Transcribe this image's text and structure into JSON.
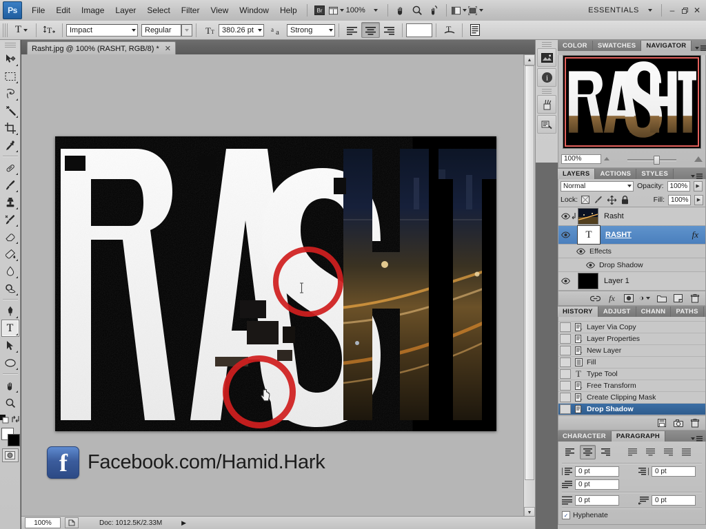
{
  "app": {
    "name": "Ps",
    "workspace": "ESSENTIALS"
  },
  "menubar": {
    "items": [
      "File",
      "Edit",
      "Image",
      "Layer",
      "Select",
      "Filter",
      "View",
      "Window",
      "Help"
    ],
    "bridge_icon": "bridge-icon",
    "arrange_icon": "arrange-documents-icon",
    "zoom_level": "100%",
    "hand_icon": "hand-tool-icon",
    "zoom_icon": "zoom-tool-icon",
    "rotate_icon": "rotate-view-tool-icon",
    "screen_mode_icon": "screen-mode-icon",
    "extras_icon": "view-extras-icon",
    "minimize": "–",
    "restore": "❐",
    "close": "✕"
  },
  "options_bar": {
    "tool_icon_label": "T",
    "orientation_label": "toggle-text-orientation",
    "font_family": "Impact",
    "font_style": "Regular",
    "font_size": "380.26 pt",
    "anti_alias": "Strong",
    "align_left": "align-text-left",
    "align_center": "align-text-center",
    "align_right": "align-text-right",
    "color_swatch": "#ffffff",
    "warp_label": "create-warped-text",
    "panel_toggle_label": "toggle-character-paragraph-panels"
  },
  "toolbar": {
    "tools": [
      {
        "name": "move-tool",
        "glyph": "✥",
        "active": false
      },
      {
        "name": "rectangular-marquee-tool",
        "glyph": "⬚",
        "active": false
      },
      {
        "name": "lasso-tool",
        "glyph": "❀",
        "active": false
      },
      {
        "name": "magic-wand-tool",
        "glyph": "✳",
        "active": false
      },
      {
        "name": "crop-tool",
        "glyph": "⌗",
        "active": false
      },
      {
        "name": "eyedropper-tool",
        "glyph": "✐",
        "active": false
      },
      {
        "name": "healing-brush-tool",
        "glyph": "⊘",
        "active": false
      },
      {
        "name": "brush-tool",
        "glyph": "✎",
        "active": false
      },
      {
        "name": "clone-stamp-tool",
        "glyph": "✑",
        "active": false
      },
      {
        "name": "history-brush-tool",
        "glyph": "✒",
        "active": false
      },
      {
        "name": "eraser-tool",
        "glyph": "▱",
        "active": false
      },
      {
        "name": "gradient-tool",
        "glyph": "◧",
        "active": false
      },
      {
        "name": "blur-tool",
        "glyph": "●",
        "active": false
      },
      {
        "name": "dodge-tool",
        "glyph": "◖",
        "active": false
      },
      {
        "name": "pen-tool",
        "glyph": "✒",
        "active": false
      },
      {
        "name": "horizontal-type-tool",
        "glyph": "T",
        "active": true
      },
      {
        "name": "path-selection-tool",
        "glyph": "➤",
        "active": false
      },
      {
        "name": "ellipse-shape-tool",
        "glyph": "⬭",
        "active": false
      },
      {
        "name": "hand-tool",
        "glyph": "✋",
        "active": false
      },
      {
        "name": "zoom-tool",
        "glyph": "⚲",
        "active": false
      }
    ],
    "foreground_color": "#ffffff",
    "background_color": "#000000",
    "swap_colors_icon": "swap-colors-icon",
    "quick_mask_icon": "quick-mask-mode-icon"
  },
  "document": {
    "tab_title": "Rasht.jpg @ 100% (RASHT, RGB/8) *",
    "close_glyph": "✕",
    "artwork_text": "RASHT",
    "footer_text": "Facebook.com/Hamid.Hark",
    "footer_icon": "facebook-icon",
    "facebook_glyph": "f",
    "annotation_1": "red-circle-annotation",
    "annotation_2": "red-circle-annotation",
    "cursor_text": "text-cursor-icon",
    "cursor_hand": "hand-pointer-icon"
  },
  "status_bar": {
    "zoom": "100%",
    "doc_info": "Doc: 1012.5K/2.33M",
    "arrow_glyph": "▶"
  },
  "icon_rail": {
    "buttons": [
      {
        "name": "mini-bridge-icon",
        "glyph": "⛰"
      },
      {
        "name": "info-icon",
        "glyph": "i"
      },
      {
        "name": "tool-presets-icon",
        "glyph": "⚒"
      },
      {
        "name": "brush-presets-icon",
        "glyph": "☷"
      }
    ]
  },
  "navigator_panel": {
    "tabs": [
      {
        "label": "COLOR",
        "selected": false
      },
      {
        "label": "SWATCHES",
        "selected": false
      },
      {
        "label": "NAVIGATOR",
        "selected": true
      }
    ],
    "thumbnail_text": "RASHT",
    "zoom_value": "100%",
    "zoom_out_icon": "zoom-out-icon",
    "zoom_in_icon": "zoom-in-icon",
    "menu_icon": "panel-menu-icon"
  },
  "layers_panel": {
    "tabs": [
      {
        "label": "LAYERS",
        "selected": true
      },
      {
        "label": "ACTIONS",
        "selected": false
      },
      {
        "label": "STYLES",
        "selected": false
      }
    ],
    "blend_mode": "Normal",
    "opacity_label": "Opacity:",
    "opacity_value": "100%",
    "lock_label": "Lock:",
    "fill_label": "Fill:",
    "fill_value": "100%",
    "lock_icons": [
      "lock-transparent-pixels-icon",
      "lock-image-pixels-icon",
      "lock-position-icon",
      "lock-all-icon"
    ],
    "layers": [
      {
        "name": "Rasht",
        "type": "image",
        "selected": false,
        "clipped": true,
        "thumb": "photo"
      },
      {
        "name": "RASHT",
        "type": "text",
        "selected": true,
        "thumb": "T",
        "has_fx": true
      },
      {
        "name": "Layer 1",
        "type": "image",
        "selected": false,
        "thumb": "black"
      }
    ],
    "effects_label": "Effects",
    "effect_items": [
      "Drop Shadow"
    ],
    "footer_icons": [
      {
        "name": "link-layers-icon",
        "glyph": "⚭"
      },
      {
        "name": "add-layer-style-icon",
        "glyph": "fx"
      },
      {
        "name": "add-layer-mask-icon",
        "glyph": "▢"
      },
      {
        "name": "new-fill-adjustment-layer-icon",
        "glyph": "◑"
      },
      {
        "name": "new-group-icon",
        "glyph": "▭"
      },
      {
        "name": "new-layer-icon",
        "glyph": "⬚"
      },
      {
        "name": "delete-layer-icon",
        "glyph": "Ὕ1"
      }
    ]
  },
  "history_panel": {
    "tabs": [
      {
        "label": "HISTORY",
        "selected": true
      },
      {
        "label": "ADJUST",
        "selected": false
      },
      {
        "label": "CHANN",
        "selected": false
      },
      {
        "label": "PATHS",
        "selected": false
      }
    ],
    "items": [
      {
        "label": "Layer Via Copy",
        "icon": "history-state-icon",
        "selected": false
      },
      {
        "label": "Layer Properties",
        "icon": "history-state-icon",
        "selected": false
      },
      {
        "label": "New Layer",
        "icon": "history-state-icon",
        "selected": false
      },
      {
        "label": "Fill",
        "icon": "fill-state-icon",
        "selected": false
      },
      {
        "label": "Type Tool",
        "icon": "type-tool-state-icon",
        "selected": false
      },
      {
        "label": "Free Transform",
        "icon": "history-state-icon",
        "selected": false
      },
      {
        "label": "Create Clipping Mask",
        "icon": "history-state-icon",
        "selected": false
      },
      {
        "label": "Drop Shadow",
        "icon": "history-state-icon",
        "selected": true
      }
    ],
    "footer_icons": [
      {
        "name": "create-document-from-state-icon",
        "glyph": "▤"
      },
      {
        "name": "create-new-snapshot-icon",
        "glyph": "◎"
      },
      {
        "name": "delete-state-icon",
        "glyph": "Ὕ1"
      }
    ]
  },
  "paragraph_panel": {
    "tabs": [
      {
        "label": "CHARACTER",
        "selected": false
      },
      {
        "label": "PARAGRAPH",
        "selected": true
      }
    ],
    "align_buttons": [
      {
        "name": "align-left-button",
        "selected": false
      },
      {
        "name": "align-center-button",
        "selected": true
      },
      {
        "name": "align-right-button",
        "selected": false
      },
      {
        "name": "justify-last-left-button",
        "selected": false
      },
      {
        "name": "justify-last-centered-button",
        "selected": false
      },
      {
        "name": "justify-last-right-button",
        "selected": false
      },
      {
        "name": "justify-all-button",
        "selected": false
      }
    ],
    "indent_left": "0 pt",
    "indent_right": "0 pt",
    "indent_first_line": "0 pt",
    "space_before": "0 pt",
    "space_after": "0 pt",
    "hyphenate_label": "Hyphenate",
    "hyphenate_checked": true,
    "check_glyph": "✓"
  }
}
